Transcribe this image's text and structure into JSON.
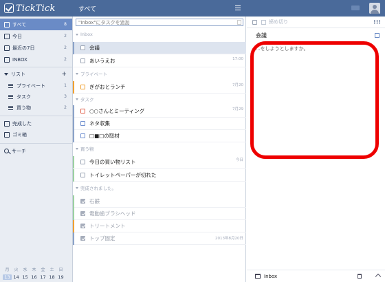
{
  "app": {
    "logo_text": "TickTick",
    "view_title": "すべて"
  },
  "search": {
    "placeholder": "\"Inbox\"にタスクを追加"
  },
  "sidebar": {
    "items": [
      {
        "label": "すべて",
        "count": "8"
      },
      {
        "label": "今日",
        "count": "2"
      },
      {
        "label": "最近の7日",
        "count": "2"
      },
      {
        "label": "INBOX",
        "count": "2"
      }
    ],
    "lists_heading": "リスト",
    "lists": [
      {
        "label": "プライベート",
        "count": "1"
      },
      {
        "label": "タスク",
        "count": "3"
      },
      {
        "label": "買う物",
        "count": "2"
      }
    ],
    "completed": "完成した",
    "trash": "ゴミ箱",
    "search": "サーチ"
  },
  "calendar": {
    "weekdays": [
      "月",
      "火",
      "水",
      "木",
      "金",
      "土",
      "日"
    ],
    "days": [
      "13",
      "14",
      "15",
      "16",
      "17",
      "18",
      "19"
    ]
  },
  "groups": [
    {
      "label": "Inbox",
      "tasks": [
        {
          "title": "会議",
          "date": ""
        },
        {
          "title": "あいうえお",
          "date": "17:00"
        }
      ]
    },
    {
      "label": "プライベート",
      "tasks": [
        {
          "title": "ぎがおとランチ",
          "date": "7月20"
        }
      ]
    },
    {
      "label": "タスク",
      "tasks": [
        {
          "title": "○○さんとミーティング",
          "date": "7月29"
        },
        {
          "title": "ネタ収集",
          "date": ""
        },
        {
          "title": "□■□の取材",
          "date": ""
        }
      ]
    },
    {
      "label": "買う物",
      "tasks": [
        {
          "title": "今日の買い物リスト",
          "date": "今日"
        },
        {
          "title": "トイレットペーパーが切れた",
          "date": ""
        }
      ]
    },
    {
      "label": "完成されました。",
      "tasks": [
        {
          "title": "石鹸",
          "date": ""
        },
        {
          "title": "電動歯ブラシヘッド",
          "date": ""
        },
        {
          "title": "トリートメント",
          "date": ""
        },
        {
          "title": "トップ固定",
          "date": "2013年8月20日"
        }
      ]
    }
  ],
  "detail": {
    "due_label": "締め切り",
    "title": "会議",
    "note": "...をしようとしますか。",
    "project": "Inbox"
  },
  "colors": {
    "accent": "#4a6a9a",
    "active": "#6a8bc6",
    "annotation": "#ee0000"
  }
}
